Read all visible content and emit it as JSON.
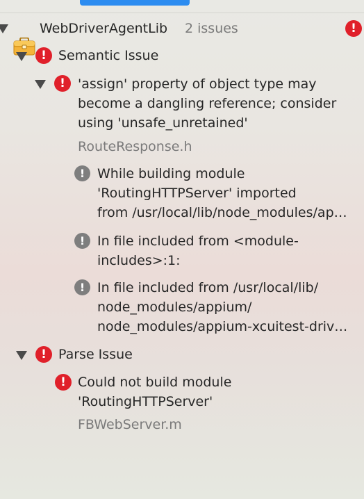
{
  "target": {
    "name": "WebDriverAgentLib",
    "count": "2 issues"
  },
  "groups": [
    {
      "title": "Semantic Issue",
      "error": {
        "message": "'assign' property of object type may become a dangling reference; consider using 'unsafe_unretained'",
        "file": "RouteResponse.h"
      },
      "notes": [
        {
          "line1": "While building module",
          "line2": "'RoutingHTTPServer' imported",
          "line3": "from /usr/local/lib/node_modules/appium/node_modules/appium-xcuitest-driver"
        },
        {
          "line1": "In file included from <module-",
          "line2": "includes>:1:"
        },
        {
          "line1": "In file included from /usr/local/lib/",
          "line2": "node_modules/appium/",
          "line3": "node_modules/appium-xcuitest-driver/WebDriverAgent"
        }
      ]
    },
    {
      "title": "Parse Issue",
      "error": {
        "line1": "Could not build module",
        "line2": "'RoutingHTTPServer'",
        "file": "FBWebServer.m"
      }
    }
  ],
  "icons": {
    "error": "error-circle-icon",
    "note": "note-circle-icon",
    "disclosure": "disclosure-triangle-icon",
    "target": "briefcase-icon"
  },
  "colors": {
    "error": "#e0202a",
    "note": "#7e7e7e",
    "selection": "#2c8cf0"
  }
}
